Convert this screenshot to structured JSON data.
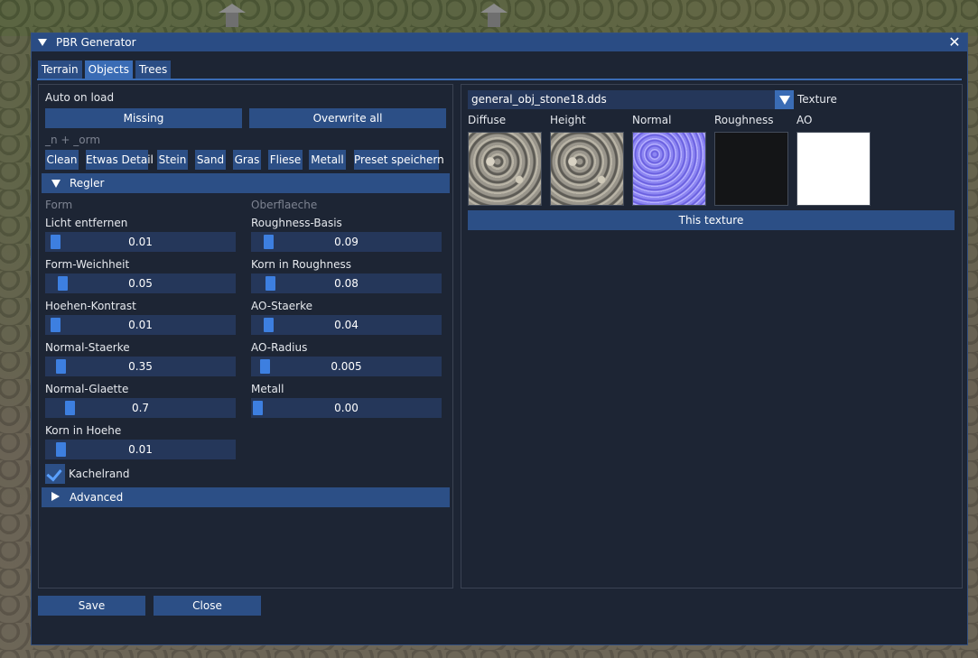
{
  "window": {
    "title": "PBR Generator",
    "close_glyph": "✕"
  },
  "tabs": [
    {
      "label": "Terrain",
      "active": false
    },
    {
      "label": "Objects",
      "active": true
    },
    {
      "label": "Trees",
      "active": false
    }
  ],
  "left": {
    "auto_on_load_label": "Auto on load",
    "missing_button": "Missing",
    "overwrite_button": "Overwrite all",
    "suffix_hint": "_n + _orm",
    "presets": [
      "Clean",
      "Etwas Detail",
      "Stein",
      "Sand",
      "Gras",
      "Fliese",
      "Metall",
      "Preset speichern"
    ],
    "regler_header": "Regler",
    "form_heading": "Form",
    "oberflaeche_heading": "Oberflaeche",
    "form_sliders": [
      {
        "label": "Licht entfernen",
        "value": "0.01",
        "fraction": 0.02
      },
      {
        "label": "Form-Weichheit",
        "value": "0.05",
        "fraction": 0.06
      },
      {
        "label": "Hoehen-Kontrast",
        "value": "0.01",
        "fraction": 0.02
      },
      {
        "label": "Normal-Staerke",
        "value": "0.35",
        "fraction": 0.05
      },
      {
        "label": "Normal-Glaette",
        "value": "0.7",
        "fraction": 0.1
      },
      {
        "label": "Korn in Hoehe",
        "value": "0.01",
        "fraction": 0.05
      }
    ],
    "surface_sliders": [
      {
        "label": "Roughness-Basis",
        "value": "0.09",
        "fraction": 0.06
      },
      {
        "label": "Korn in Roughness",
        "value": "0.08",
        "fraction": 0.07
      },
      {
        "label": "AO-Staerke",
        "value": "0.04",
        "fraction": 0.06
      },
      {
        "label": "AO-Radius",
        "value": "0.005",
        "fraction": 0.04
      },
      {
        "label": "Metall",
        "value": "0.00",
        "fraction": 0.0
      }
    ],
    "kachelrand_label": "Kachelrand",
    "kachelrand_checked": true,
    "advanced_header": "Advanced"
  },
  "right": {
    "texture_combo_value": "general_obj_stone18.dds",
    "texture_label": "Texture",
    "maps": [
      "Diffuse",
      "Height",
      "Normal",
      "Roughness",
      "AO"
    ],
    "this_texture_button": "This texture"
  },
  "footer": {
    "save_button": "Save",
    "close_button": "Close"
  },
  "colors": {
    "accent": "#3a6cb5",
    "button": "#2c4f86",
    "slider_bg": "#25375a",
    "grab": "#3d7fe0",
    "window_bg": "#1d2534"
  }
}
